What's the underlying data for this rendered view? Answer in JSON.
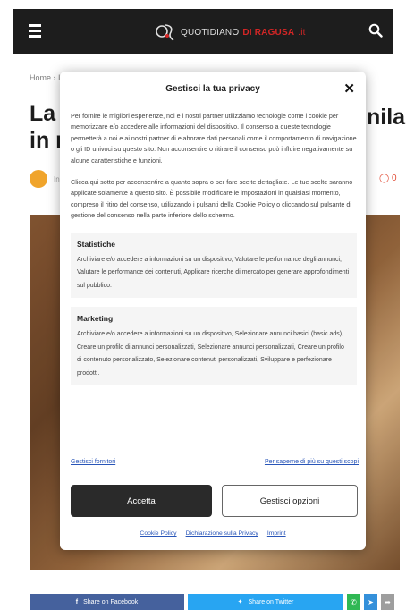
{
  "header": {
    "logo_prefix": "QUOTIDIANO",
    "logo_highlight": "DI RAGUSA",
    "logo_suffix": ".it"
  },
  "article": {
    "breadcrumb": "Home › Ital",
    "title_left_line1": "La p",
    "title_left_line2": "in m",
    "title_right": "nila",
    "author": "In",
    "comments": "0"
  },
  "share": {
    "facebook_label": "Share on Facebook",
    "twitter_label": "Share on Twitter"
  },
  "modal": {
    "title": "Gestisci la tua privacy",
    "close_label": "✕",
    "paragraph1": "Per fornire le migliori esperienze, noi e i nostri partner utilizziamo tecnologie come i cookie per memorizzare e/o accedere alle informazioni del dispositivo. Il consenso a queste tecnologie permetterà a noi e ai nostri partner di elaborare dati personali come il comportamento di navigazione o gli ID univoci su questo sito. Non acconsentire o ritirare il consenso può influire negativamente su alcune caratteristiche e funzioni.",
    "paragraph2": "Clicca qui sotto per acconsentire a quanto sopra o per fare scelte dettagliate. Le tue scelte saranno applicate solamente a questo sito. È possibile modificare le impostazioni in qualsiasi momento, compreso il ritiro del consenso, utilizzando i pulsanti della Cookie Policy o cliccando sul pulsante di gestione del consenso nella parte inferiore dello schermo.",
    "preferences": [
      {
        "title": "Statistiche",
        "description": "Archiviare e/o accedere a informazioni su un dispositivo, Valutare le performance degli annunci, Valutare le performance dei contenuti, Applicare ricerche di mercato per generare approfondimenti sul pubblico."
      },
      {
        "title": "Marketing",
        "description": "Archiviare e/o accedere a informazioni su un dispositivo, Selezionare annunci basici (basic ads), Creare un profilo di annunci personalizzati, Selezionare annunci personalizzati, Creare un profilo di contenuto personalizzato, Selezionare contenuti personalizzati, Sviluppare e perfezionare i prodotti."
      }
    ],
    "manage_vendors_link": "Gestisci fornitori",
    "read_more_link": "Per saperne di più su questi scopi",
    "accept_label": "Accetta",
    "manage_options_label": "Gestisci opzioni",
    "footer_links": [
      "Cookie Policy",
      "Dichiarazione sulla Privacy",
      "Imprint"
    ]
  }
}
